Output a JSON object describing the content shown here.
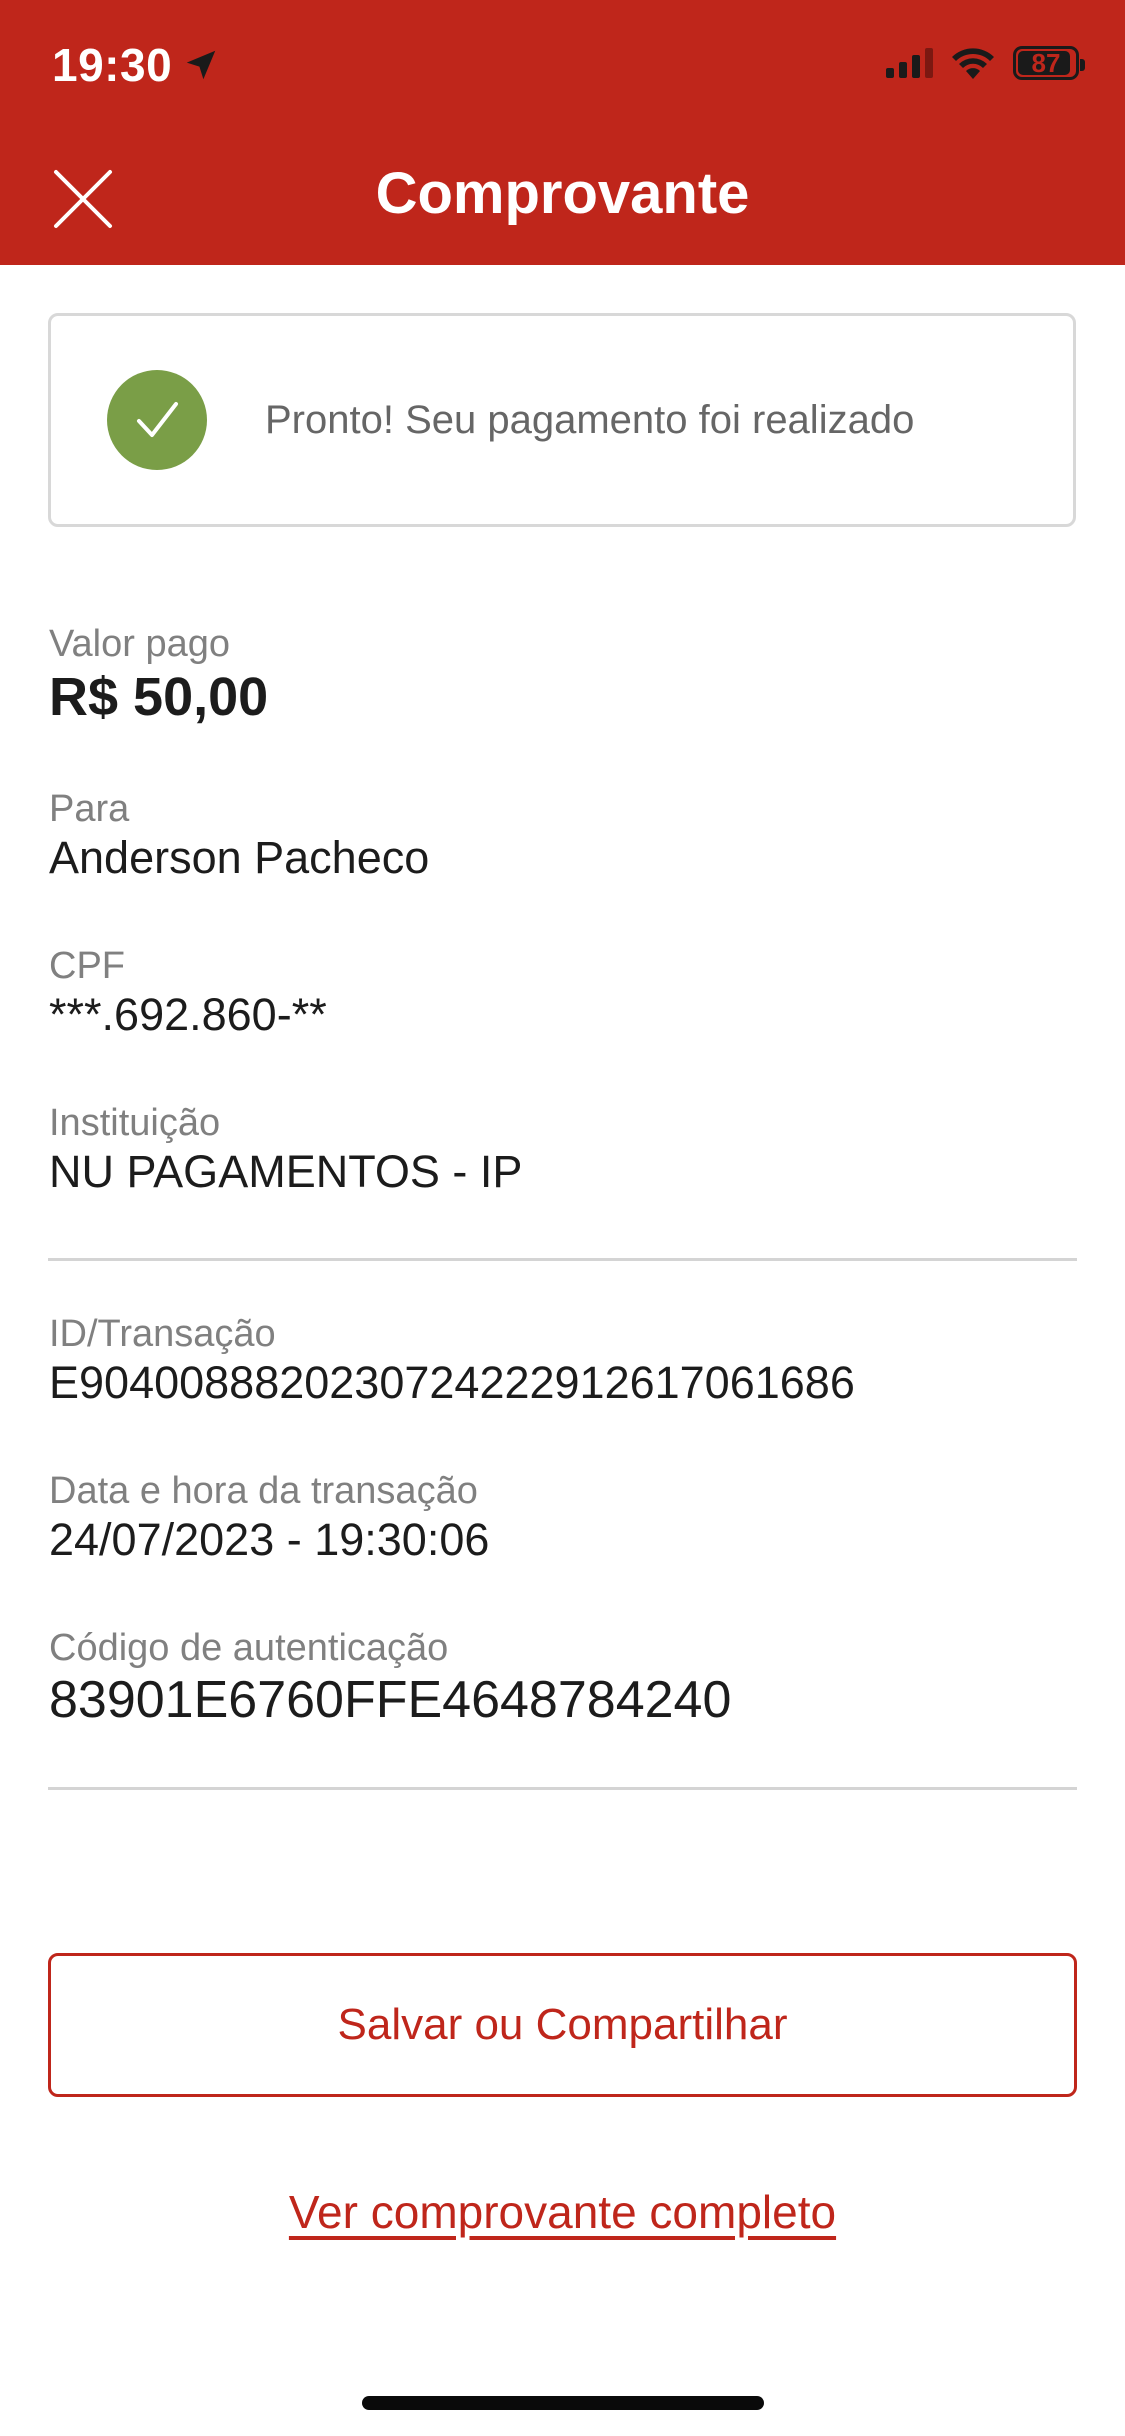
{
  "status_bar": {
    "time": "19:30",
    "battery": "87",
    "icons": [
      "location-arrow-icon",
      "cellular-signal-icon",
      "wifi-icon",
      "battery-icon"
    ]
  },
  "header": {
    "title": "Comprovante",
    "close_icon": "close-icon",
    "background_color": "#bf261b"
  },
  "success": {
    "message": "Pronto! Seu pagamento foi realizado",
    "icon": "check-circle-icon",
    "icon_color": "#7a9e47"
  },
  "payment": {
    "amount_label": "Valor pago",
    "amount": "R$ 50,00",
    "recipient_label": "Para",
    "recipient": "Anderson Pacheco",
    "cpf_label": "CPF",
    "cpf": "***.692.860-**",
    "institution_label": "Instituição",
    "institution": "NU PAGAMENTOS - IP"
  },
  "transaction": {
    "id_label": "ID/Transação",
    "id": "E90400888202307242229126170616​86",
    "datetime_label": "Data e hora da transação",
    "datetime": "24/07/2023 - 19:30:06",
    "auth_label": "Código de autenticação",
    "auth_code": "83901E6760FFE4648784240"
  },
  "actions": {
    "save_share_label": "Salvar ou Compartilhar",
    "full_receipt_label": "Ver comprovante completo",
    "accent_color": "#bf261b"
  }
}
